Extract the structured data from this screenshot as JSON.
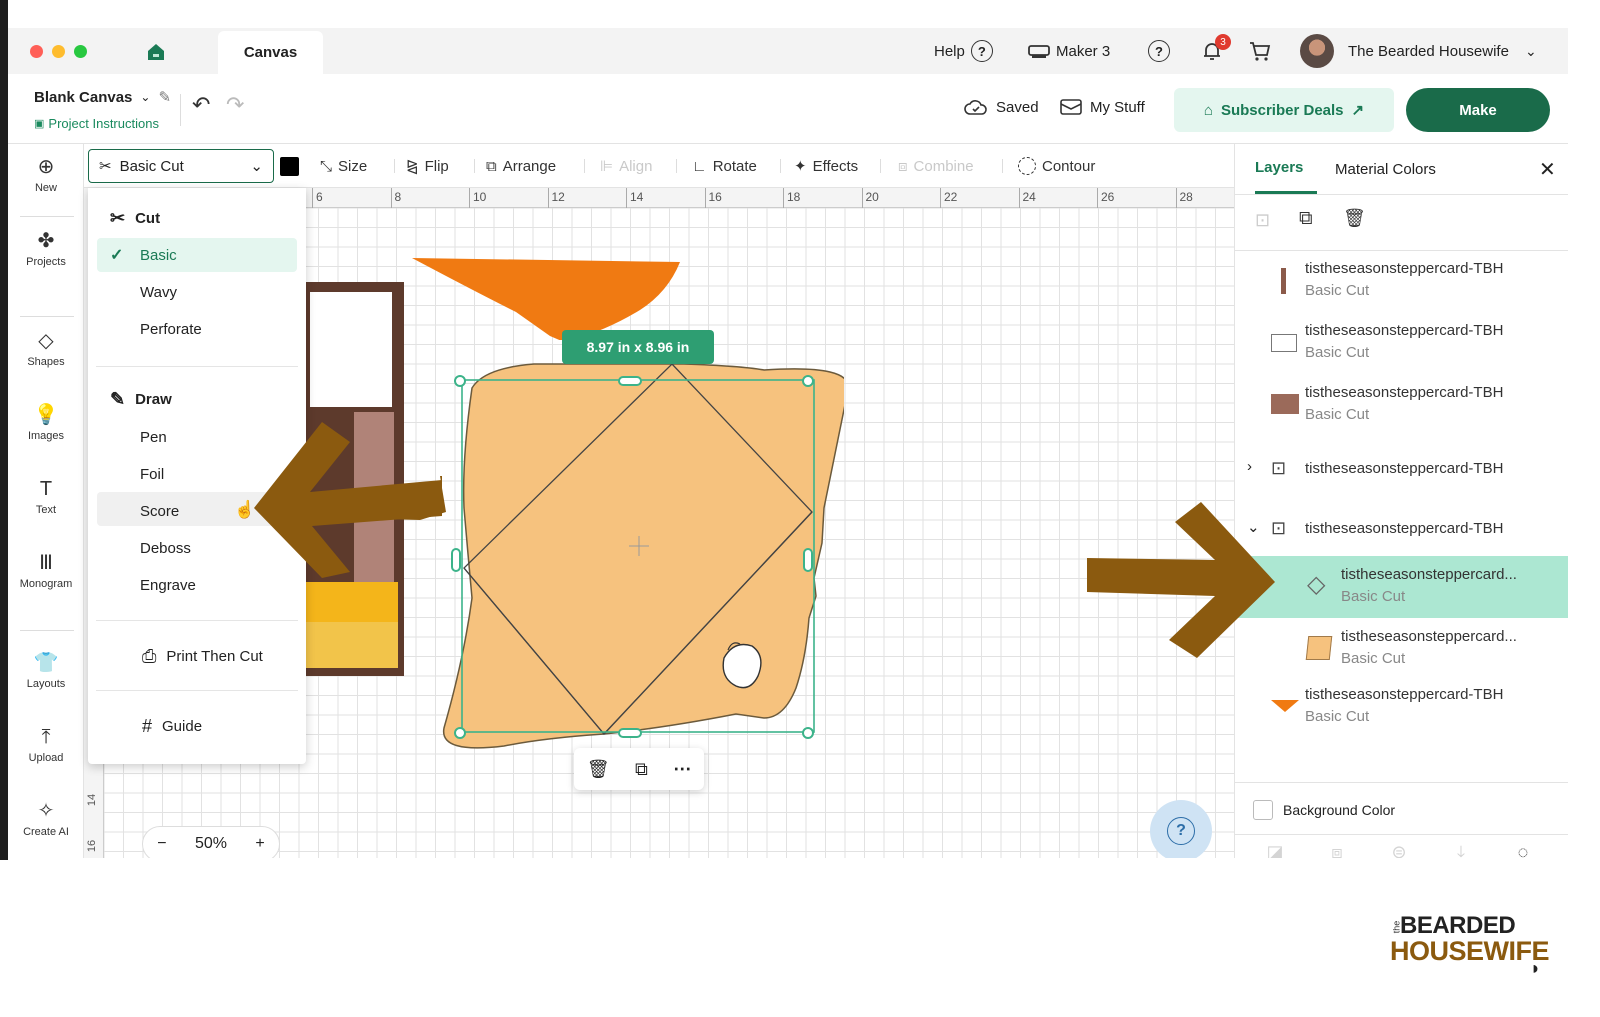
{
  "titlebar": {
    "tab": "Canvas",
    "help": "Help",
    "machine": "Maker 3",
    "notif_count": "3",
    "user": "The Bearded Housewife"
  },
  "header": {
    "project": "Blank Canvas",
    "instructions": "Project Instructions",
    "saved": "Saved",
    "mystuff": "My Stuff",
    "deals": "Subscriber Deals",
    "make": "Make"
  },
  "rail": [
    {
      "label": "New",
      "icon": "plus-circle-icon"
    },
    {
      "label": "Projects",
      "icon": "projects-icon"
    },
    {
      "label": "Shapes",
      "icon": "shapes-icon"
    },
    {
      "label": "Images",
      "icon": "bulb-icon"
    },
    {
      "label": "Text",
      "icon": "text-icon"
    },
    {
      "label": "Monogram",
      "icon": "monogram-icon"
    },
    {
      "label": "Layouts",
      "icon": "shirt-icon"
    },
    {
      "label": "Upload",
      "icon": "upload-icon"
    },
    {
      "label": "Create AI",
      "icon": "sparkle-icon"
    }
  ],
  "toolbar": {
    "operation": "Basic Cut",
    "size": "Size",
    "flip": "Flip",
    "arrange": "Arrange",
    "align": "Align",
    "rotate": "Rotate",
    "effects": "Effects",
    "combine": "Combine",
    "contour": "Contour"
  },
  "ruler": [
    "6",
    "8",
    "10",
    "12",
    "14",
    "16",
    "18",
    "20",
    "22",
    "24",
    "26",
    "28"
  ],
  "ruler_left": [
    "14",
    "16"
  ],
  "dropdown": {
    "cut": "Cut",
    "cut_items": [
      "Basic",
      "Wavy",
      "Perforate"
    ],
    "draw": "Draw",
    "draw_items": [
      "Pen",
      "Foil",
      "Score",
      "Deboss",
      "Engrave"
    ],
    "ptc": "Print Then Cut",
    "guide": "Guide"
  },
  "canvas": {
    "dimension": "8.97 in x 8.96 in",
    "zoom": "50%",
    "zoom_minus": "−",
    "zoom_plus": "+"
  },
  "panel": {
    "tab_layers": "Layers",
    "tab_colors": "Material Colors",
    "layers": [
      {
        "name": "tistheseasonsteppercard-TBH",
        "op": "Basic Cut",
        "color": "#8b5a4a"
      },
      {
        "name": "tistheseasonsteppercard-TBH",
        "op": "Basic Cut",
        "color": "#ffffff"
      },
      {
        "name": "tistheseasonsteppercard-TBH",
        "op": "Basic Cut",
        "color": "#9b6a5a"
      },
      {
        "name": "tistheseasonsteppercard-TBH",
        "op": ""
      },
      {
        "name": "tistheseasonsteppercard-TBH",
        "op": ""
      },
      {
        "name": "tistheseasonsteppercard...",
        "op": "Basic Cut"
      },
      {
        "name": "tistheseasonsteppercard...",
        "op": "Basic Cut",
        "color": "#f6c27e"
      },
      {
        "name": "tistheseasonsteppercard-TBH",
        "op": "Basic Cut",
        "color": "#f07a12"
      }
    ],
    "bg_color": "Background Color",
    "bottom": [
      "Slice",
      "Combine",
      "Attach",
      "Flatten",
      "Contour"
    ]
  },
  "watermark": {
    "line1": "the",
    "line2": "BEARDED",
    "line3": "HOUSEWIFE"
  },
  "colors": {
    "accent": "#1a6b4a",
    "selected_row": "#ace7d2",
    "arrow": "#8b5a0f",
    "envelope": "#f6c27e",
    "orange": "#f07a12"
  }
}
